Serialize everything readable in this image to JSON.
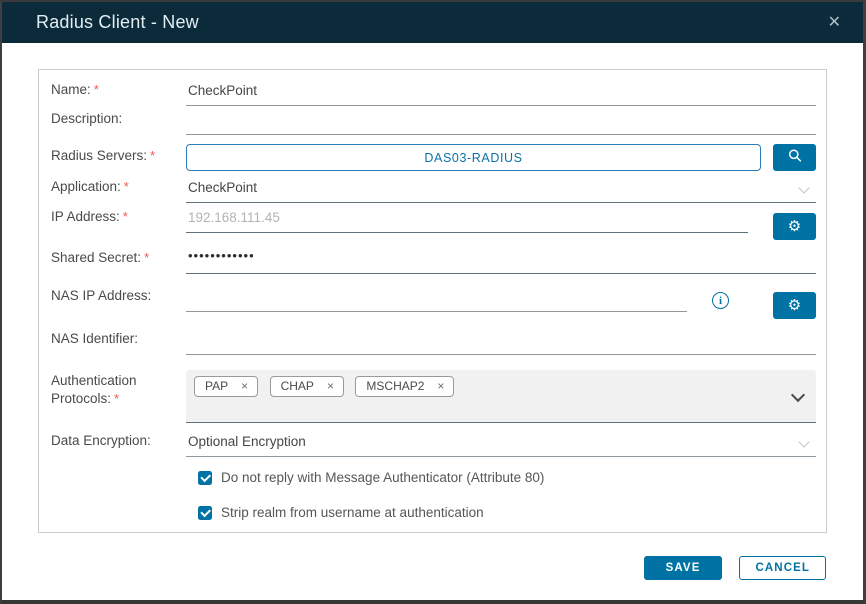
{
  "titlebar": {
    "title": "Radius Client - New"
  },
  "icons": {
    "close": "✕",
    "gear": "⚙",
    "chip_remove": "×",
    "info": "i"
  },
  "fields": {
    "name": {
      "label": "Name:",
      "required": "*",
      "value": "CheckPoint"
    },
    "description": {
      "label": "Description:",
      "value": ""
    },
    "radius_servers": {
      "label": "Radius Servers:",
      "required": "*",
      "value": "DAS03-RADIUS"
    },
    "application": {
      "label": "Application:",
      "required": "*",
      "value": "CheckPoint"
    },
    "ip_address": {
      "label": "IP Address:",
      "required": "*",
      "placeholder": "192.168.111.45",
      "value": ""
    },
    "shared_secret": {
      "label": "Shared Secret:",
      "required": "*",
      "value": "••••••••••••"
    },
    "nas_ip_address": {
      "label": "NAS IP Address:",
      "value": ""
    },
    "nas_identifier": {
      "label": "NAS Identifier:",
      "value": ""
    },
    "authentication_protocols": {
      "label_line1": "Authentication",
      "label_line2": "Protocols:",
      "required": "*",
      "chips": [
        "PAP",
        "CHAP",
        "MSCHAP2"
      ]
    },
    "data_encryption": {
      "label": "Data Encryption:",
      "value": "Optional Encryption"
    }
  },
  "checkboxes": [
    {
      "label": "Do not reply with Message Authenticator (Attribute 80)",
      "checked": true
    },
    {
      "label": "Strip realm from username at authentication",
      "checked": true
    }
  ],
  "buttons": {
    "save": "SAVE",
    "cancel": "CANCEL"
  },
  "colors": {
    "accent": "#0072a3",
    "header_bg": "#0c2b3a",
    "required_marker": "#f25550"
  }
}
